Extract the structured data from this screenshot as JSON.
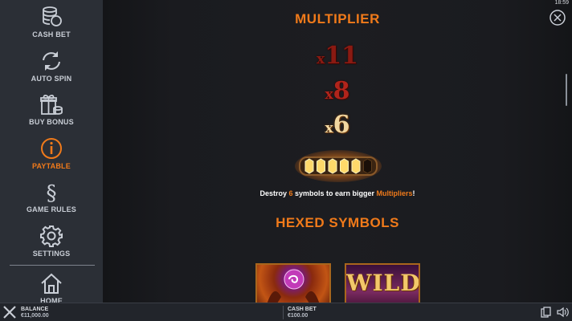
{
  "status": {
    "time": "18:59"
  },
  "sidebar": {
    "items": [
      {
        "label": "CASH BET",
        "icon": "coins-stack-icon"
      },
      {
        "label": "AUTO SPIN",
        "icon": "refresh-arrows-icon"
      },
      {
        "label": "BUY BONUS",
        "icon": "gift-coins-icon"
      },
      {
        "label": "PAYTABLE",
        "icon": "info-icon",
        "active": true
      },
      {
        "label": "GAME RULES",
        "icon": "section-sign-icon"
      },
      {
        "label": "SETTINGS",
        "icon": "gear-icon"
      },
      {
        "label": "HOME",
        "icon": "home-icon"
      }
    ]
  },
  "paytable": {
    "multiplier_title": "MULTIPLIER",
    "multipliers": [
      {
        "x": "x",
        "value": "11"
      },
      {
        "x": "x",
        "value": "8"
      },
      {
        "x": "x",
        "value": "6"
      }
    ],
    "meter": {
      "filled": 5,
      "total": 6
    },
    "description": {
      "part1": "Destroy ",
      "count": "6",
      "part2": " symbols to earn bigger ",
      "highlight": "Multipliers",
      "part3": "!"
    },
    "hexed_title": "HEXED SYMBOLS",
    "symbols": [
      {
        "icon": "hex-orb-icon"
      },
      {
        "label": "WILD",
        "icon": "wild-symbol-icon"
      }
    ]
  },
  "bottom_bar": {
    "balance_label": "BALANCE",
    "balance_value": "€11,000.00",
    "cash_bet_label": "CASH BET",
    "cash_bet_value": "€100.00"
  },
  "colors": {
    "accent": "#f07a1a",
    "sidebar_bg": "#2b2f36",
    "text": "#c9ced6"
  }
}
